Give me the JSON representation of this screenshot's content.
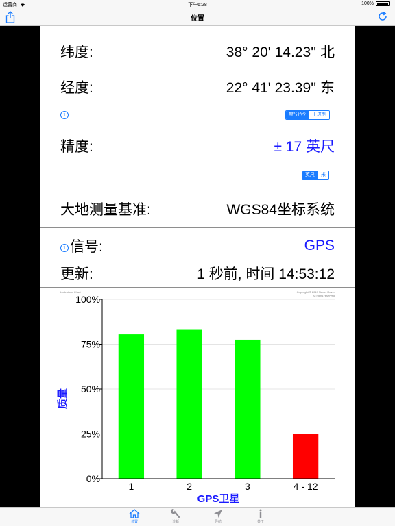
{
  "status": {
    "carrier": "运营商",
    "time": "下午6:28",
    "battery": "100%"
  },
  "nav": {
    "title": "位置"
  },
  "location": {
    "lat_label": "纬度:",
    "lat_value": "38° 20' 14.23'' 北",
    "lon_label": "经度:",
    "lon_value": "22° 41' 23.39'' 东",
    "format_options": [
      "度/分/秒",
      "十进制"
    ],
    "format_selected": "度/分/秒",
    "accuracy_label": "精度:",
    "accuracy_value": "± 17 英尺",
    "unit_options": [
      "英尺",
      "米"
    ],
    "unit_selected": "英尺",
    "datum_label": "大地测量基准:",
    "datum_value": "WGS84坐标系统"
  },
  "signal": {
    "signal_label": "信号:",
    "signal_value": "GPS",
    "update_label": "更新:",
    "update_value": "1 秒前, 时间 14:53:12"
  },
  "chart_data": {
    "type": "bar",
    "title": "Lodestone Chart",
    "copyright": [
      "Copyright © 2019 Nexus Rover",
      "All rights reserved"
    ],
    "categories": [
      "1",
      "2",
      "3",
      "4 - 12"
    ],
    "values": [
      80.5,
      83,
      77.5,
      25
    ],
    "bar_colors": [
      "#00ff00",
      "#00ff00",
      "#00ff00",
      "#ff0000"
    ],
    "xlabel": "GPS卫星",
    "ylabel": "质量",
    "ylim": [
      0,
      100
    ],
    "yticks": [
      "0%",
      "25%",
      "50%",
      "75%",
      "100%"
    ],
    "grid": true
  },
  "tabs": [
    {
      "label": "位置",
      "icon": "home-icon",
      "active": true
    },
    {
      "label": "诊断",
      "icon": "wrench-icon",
      "active": false
    },
    {
      "label": "导航",
      "icon": "navigation-arrow-icon",
      "active": false
    },
    {
      "label": "关于",
      "icon": "info-icon",
      "active": false
    }
  ],
  "colors": {
    "accent": "#1a7cff",
    "value_blue": "#1a1aff",
    "axis_label": "#1a1aff"
  }
}
